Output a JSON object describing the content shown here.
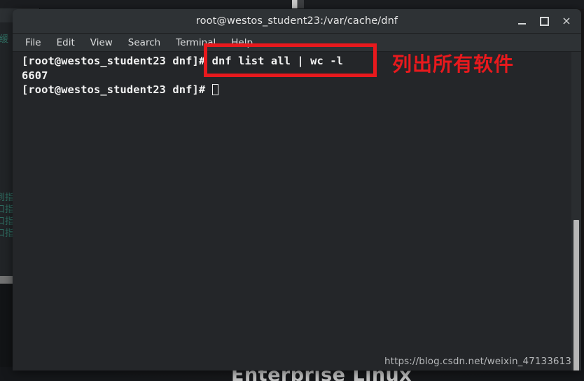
{
  "window": {
    "title": "root@westos_student23:/var/cache/dnf",
    "controls": {
      "minimize": "_",
      "maximize": "□",
      "close": "×"
    }
  },
  "menubar": {
    "items": [
      {
        "label": "File"
      },
      {
        "label": "Edit"
      },
      {
        "label": "View"
      },
      {
        "label": "Search"
      },
      {
        "label": "Terminal"
      },
      {
        "label": "Help"
      }
    ]
  },
  "terminal": {
    "prompt": "[root@westos_student23 dnf]# ",
    "command": "dnf list all | wc -l",
    "output": "6607",
    "line1": "[root@westos_student23 dnf]# dnf list all | wc -l",
    "line2": "6607",
    "line3": "[root@westos_student23 dnf]# "
  },
  "annotation": {
    "text": "列出所有软件",
    "color": "#e8191d",
    "box_target": "dnf list all | wc -l"
  },
  "watermark": {
    "text": "https://blog.csdn.net/weixin_47133613"
  },
  "desktop": {
    "wallpaper_text": "Enterprise Linux",
    "background_window_text": "到指\n口指\n口指\n口指",
    "background_window_glyph": "缓"
  },
  "colors": {
    "terminal_bg": "#242629",
    "titlebar_bg": "#2e3235",
    "terminal_fg": "#f2f2f2",
    "annotation_red": "#e8191d",
    "scrollbar_thumb": "#b7b7b7"
  }
}
